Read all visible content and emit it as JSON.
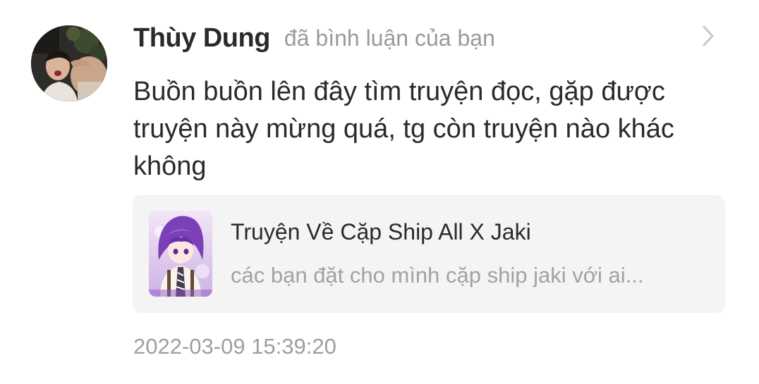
{
  "notification": {
    "user_name": "Thùy Dung",
    "action_text": "đã bình luận của bạn",
    "comment": "Buồn buồn lên đây tìm truyện đọc, gặp được truyện này mừng quá, tg còn truyện nào khác không",
    "timestamp": "2022-03-09 15:39:20",
    "chevron_icon": "chevron-right-icon",
    "story": {
      "title": "Truyện Về Cặp Ship All X Jaki",
      "description": "các bạn đặt cho mình cặp ship jaki với ai..."
    }
  },
  "colors": {
    "text_primary": "#2a2a2a",
    "text_secondary": "#9a9a9a",
    "card_background": "#f4f4f4",
    "chevron": "#c8c8c8"
  }
}
